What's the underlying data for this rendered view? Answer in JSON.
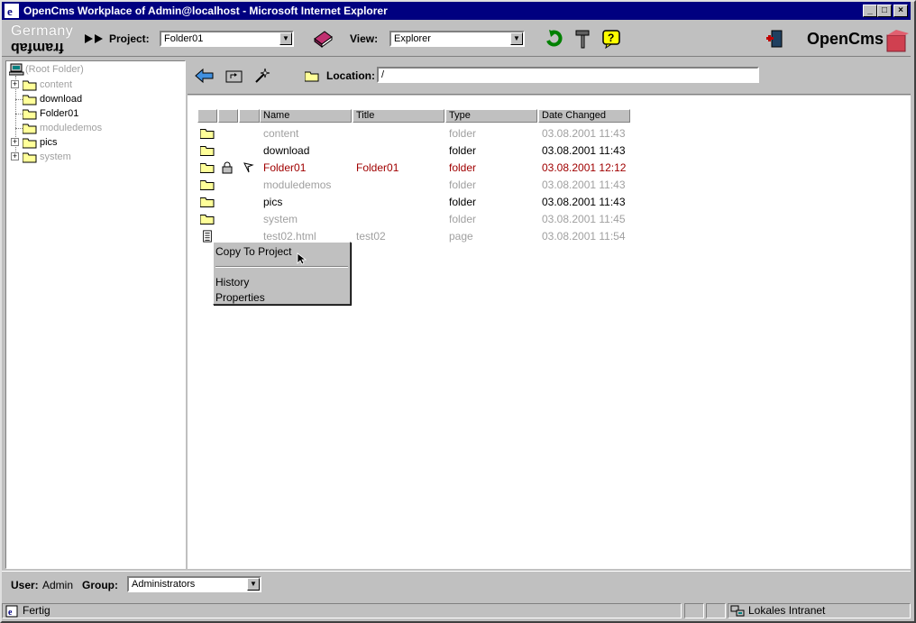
{
  "window": {
    "title": "OpenCms Workplace of Admin@localhost - Microsoft Internet Explorer",
    "min_glyph": "_",
    "max_glyph": "□",
    "close_glyph": "×"
  },
  "header": {
    "logo_top": "Germany",
    "logo_bottom": "framfab",
    "project_label": "Project:",
    "project_value": "Folder01",
    "view_label": "View:",
    "view_value": "Explorer",
    "brand": "OpenCms",
    "icons": [
      "forward-arrows-icon",
      "publish-book-icon",
      "reload-icon",
      "tools-hammer-icon",
      "help-icon",
      "exit-door-icon"
    ]
  },
  "tree": {
    "root": "(Root Folder)",
    "items": [
      {
        "label": "content",
        "dim": true,
        "expandable": true
      },
      {
        "label": "download",
        "dim": false,
        "expandable": false
      },
      {
        "label": "Folder01",
        "dim": false,
        "expandable": false
      },
      {
        "label": "moduledemos",
        "dim": true,
        "expandable": false
      },
      {
        "label": "pics",
        "dim": false,
        "expandable": true
      },
      {
        "label": "system",
        "dim": true,
        "expandable": true
      }
    ]
  },
  "location": {
    "label": "Location:",
    "value": "/"
  },
  "table": {
    "headers": [
      "Name",
      "Title",
      "Type",
      "Date Changed"
    ],
    "rows": [
      {
        "name": "content",
        "title": "",
        "type": "folder",
        "date": "03.08.2001 11:43",
        "style": "dim",
        "icon": "folder"
      },
      {
        "name": "download",
        "title": "",
        "type": "folder",
        "date": "03.08.2001 11:43",
        "style": "norm",
        "icon": "folder"
      },
      {
        "name": "Folder01",
        "title": "Folder01",
        "type": "folder",
        "date": "03.08.2001 12:12",
        "style": "red",
        "icon": "folder",
        "locked": true,
        "flag": true
      },
      {
        "name": "moduledemos",
        "title": "",
        "type": "folder",
        "date": "03.08.2001 11:43",
        "style": "dim",
        "icon": "folder"
      },
      {
        "name": "pics",
        "title": "",
        "type": "folder",
        "date": "03.08.2001 11:43",
        "style": "norm",
        "icon": "folder"
      },
      {
        "name": "system",
        "title": "",
        "type": "folder",
        "date": "03.08.2001 11:45",
        "style": "dim",
        "icon": "folder"
      },
      {
        "name": "test02.html",
        "title": "test02",
        "type": "page",
        "date": "03.08.2001 11:54",
        "style": "dim",
        "icon": "page"
      }
    ]
  },
  "context_menu": {
    "items": [
      "Copy To Project",
      "History",
      "Properties"
    ]
  },
  "footer": {
    "user_label": "User:",
    "user_value": "Admin",
    "group_label": "Group:",
    "group_value": "Administrators"
  },
  "status": {
    "text": "Fertig",
    "zone": "Lokales Intranet"
  }
}
